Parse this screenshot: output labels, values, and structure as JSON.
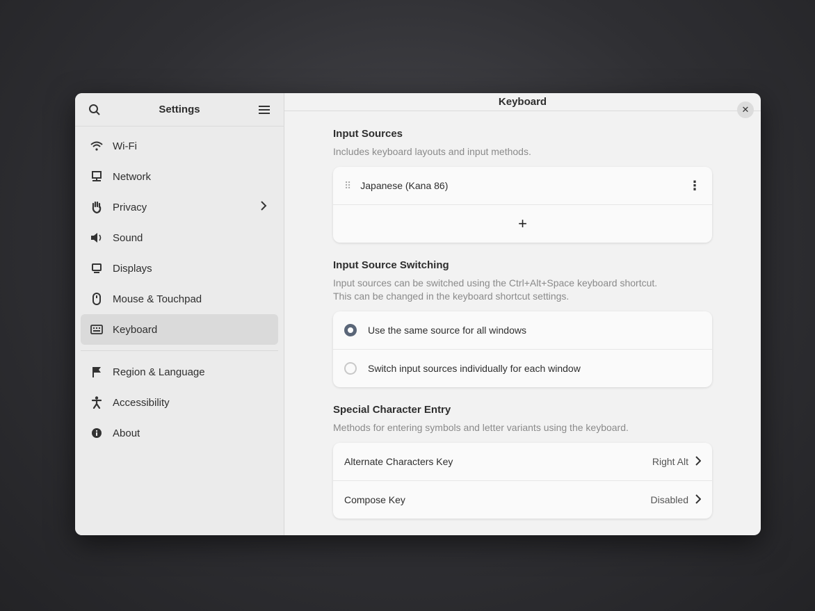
{
  "sidebar": {
    "title": "Settings",
    "items": [
      {
        "label": "Wi-Fi",
        "icon": "wifi-icon"
      },
      {
        "label": "Network",
        "icon": "network-icon"
      },
      {
        "label": "Privacy",
        "icon": "hand-icon"
      },
      {
        "label": "Sound",
        "icon": "speaker-icon"
      },
      {
        "label": "Displays",
        "icon": "display-icon"
      },
      {
        "label": "Mouse & Touchpad",
        "icon": "mouse-icon"
      },
      {
        "label": "Keyboard",
        "icon": "keyboard-icon"
      },
      {
        "label": "Region & Language",
        "icon": "flag-icon"
      },
      {
        "label": "Accessibility",
        "icon": "accessibility-icon"
      },
      {
        "label": "About",
        "icon": "info-icon"
      }
    ]
  },
  "main": {
    "title": "Keyboard",
    "input_sources": {
      "title": "Input Sources",
      "subtitle": "Includes keyboard layouts and input methods.",
      "source": "Japanese (Kana 86)",
      "add_label": "+"
    },
    "switching": {
      "title": "Input Source Switching",
      "subtitle_1": "Input sources can be switched using the Ctrl+Alt+Space keyboard shortcut.",
      "subtitle_2": "This can be changed in the keyboard shortcut settings.",
      "option_same": "Use the same source for all windows",
      "option_individual": "Switch input sources individually for each window"
    },
    "special": {
      "title": "Special Character Entry",
      "subtitle": "Methods for entering symbols and letter variants using the keyboard.",
      "alt_label": "Alternate Characters Key",
      "alt_value": "Right Alt",
      "compose_label": "Compose Key",
      "compose_value": "Disabled"
    }
  },
  "colors": {
    "radio_accent": "#5a6678",
    "active_item": "#dadada"
  }
}
